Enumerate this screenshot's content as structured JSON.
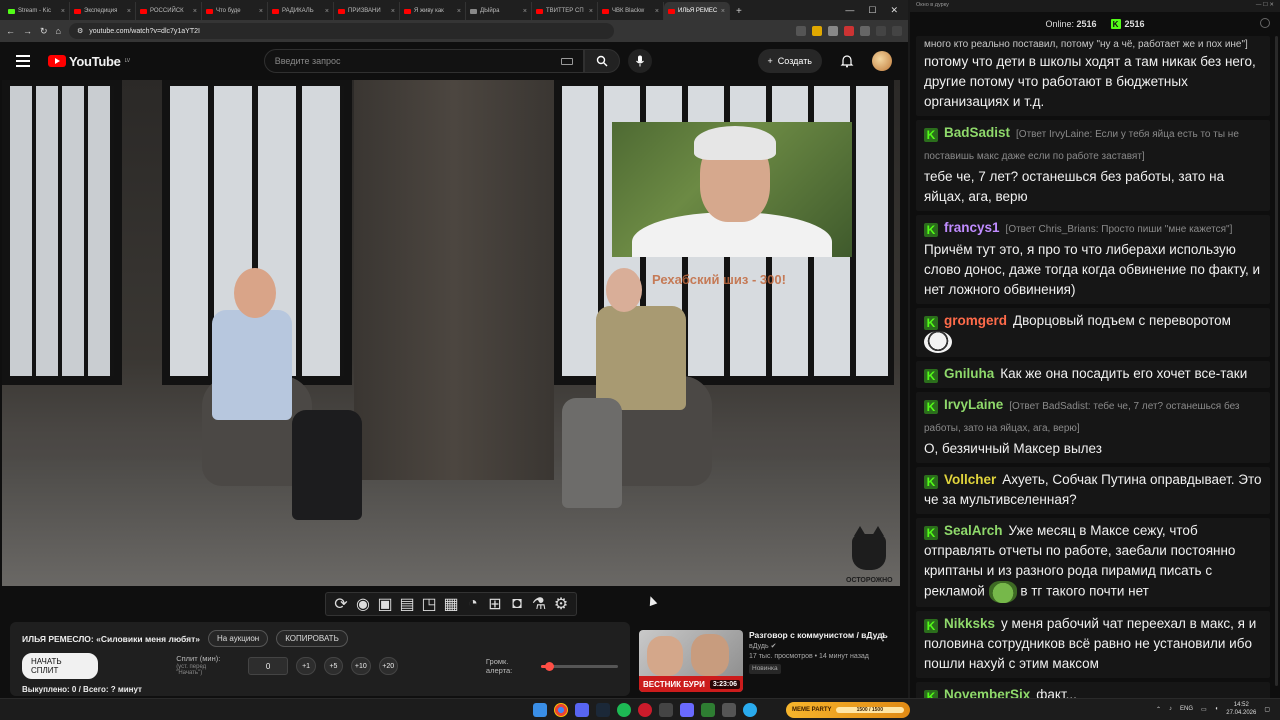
{
  "browser": {
    "tabs": [
      {
        "label": "Stream - Kic",
        "color": "#53fc18"
      },
      {
        "label": "Экспедиция",
        "color": "#ff0000"
      },
      {
        "label": "РОССИЙСК",
        "color": "#ff0000"
      },
      {
        "label": "Что буде",
        "color": "#ff0000"
      },
      {
        "label": "РАДИКАЛЬ",
        "color": "#ff0000"
      },
      {
        "label": "ПРИЗВАНИ",
        "color": "#ff0000"
      },
      {
        "label": "Я живу как",
        "color": "#ff0000"
      },
      {
        "label": "ДЫйра",
        "color": "#888888"
      },
      {
        "label": "ТВИТТЕР СП",
        "color": "#ff0000"
      },
      {
        "label": "ЧВК Blackw",
        "color": "#ff0000"
      },
      {
        "label": "ИЛЬЯ РЕМЕС",
        "color": "#ff0000",
        "active": true
      }
    ],
    "new_tab": "+",
    "url": "youtube.com/watch?v=dlc7y1aYT2I"
  },
  "youtube": {
    "logo_text": "YouTube",
    "region": "LV",
    "search_placeholder": "Введите запрос",
    "create_label": "Создать",
    "overlay_caption": "Рехабский шиз - 300!",
    "watermark_text": "ОСТОРОЖНО"
  },
  "panel": {
    "title": "ИЛЬЯ РЕМЕСЛО: «Силовики меня любят»",
    "auction_label": "На аукцион",
    "copy_label": "КОПИРОВАТЬ",
    "start_split_label": "НАЧАТЬ СПЛИТ",
    "split_label": "Сплит (мин):",
    "split_hint": "(уст. перед \"Начать\")",
    "split_value": "0",
    "steps": [
      "+1",
      "+5",
      "+10",
      "+20"
    ],
    "volume_label": "Громк. алерта:",
    "volume_level": 0.1,
    "status": "Выкуплено: 0 / Всего: ? минут"
  },
  "recommended": {
    "title": "Разговор с коммунистом / вДудь",
    "channel": "вДудь",
    "stats": "17 тыс. просмотров • 14 минут назад",
    "badge": "Новинка",
    "duration": "3:23:06",
    "thumb_text": "ВЕСТНИК БУРИ"
  },
  "chat": {
    "window_title": "Окно в дурку",
    "online_label": "Online:",
    "online_count": "2516",
    "viewers": "2516",
    "messages": [
      {
        "user": "",
        "color": "#ffffff",
        "reply": "много кто реально поставил, потому \"ну а чё, работает же и пох ине\"]",
        "text": "потому что дети в школы ходят а там никак без него, другие потому что работают в бюджетных организациях и т.д."
      },
      {
        "user": "BadSadist",
        "color": "#8fd96b",
        "reply": "[Ответ IrvyLaine: Если у тебя яйца есть то ты не поставишь макс даже если по работе заставят]",
        "text": "тебе че, 7 лет? останешься без работы, зато на яйцах, ага, верю"
      },
      {
        "user": "francys1",
        "color": "#c08cff",
        "reply": "[Ответ Chris_Brians: Просто пиши \"мне кажется\"]",
        "text": "Причём тут это, я про то что либерахи использую слово донос, даже тогда когда обвинение по факту, и нет ложного обвинения)"
      },
      {
        "user": "gromgerd",
        "color": "#ff6b4a",
        "reply": "",
        "text": "Дворцовый подъем с переворотом"
      },
      {
        "user": "Gniluha",
        "color": "#8fd96b",
        "reply": "",
        "text": "Как же она посадить его хочет все-таки"
      },
      {
        "user": "IrvyLaine",
        "color": "#8fd96b",
        "reply": "[Ответ BadSadist: тебе че, 7 лет? останешься без работы, зато на яйцах, ага, верю]",
        "text": "О, безяичный Максер вылез"
      },
      {
        "user": "Vollcher",
        "color": "#e0d43c",
        "reply": "",
        "text": "Ахуеть, Собчак Путина оправдывает. Это че за мультивселенная?"
      },
      {
        "user": "SealArch",
        "color": "#8fd96b",
        "reply": "",
        "text": "Уже месяц в Максе сежу, чтоб отправлять отчеты по работе, заебали постоянно криптаны и из разного рода пирамид писать с рекламой",
        "text2": "в тг такого почти нет"
      },
      {
        "user": "Nikksks",
        "color": "#8fd96b",
        "reply": "",
        "text": "у меня рабочий чат переехал в макс, я и половина сотрудников всё равно не установили ибо пошли нахуй с этим максом"
      },
      {
        "user": "NovemberSix",
        "color": "#8fd96b",
        "reply": "",
        "text": "факт..."
      }
    ]
  },
  "taskbar": {
    "meme_label": "MEME PARTY",
    "meme_progress": "1500 / 1500",
    "lang": "ENG",
    "time": "14:52",
    "date": "27.04.2026"
  }
}
